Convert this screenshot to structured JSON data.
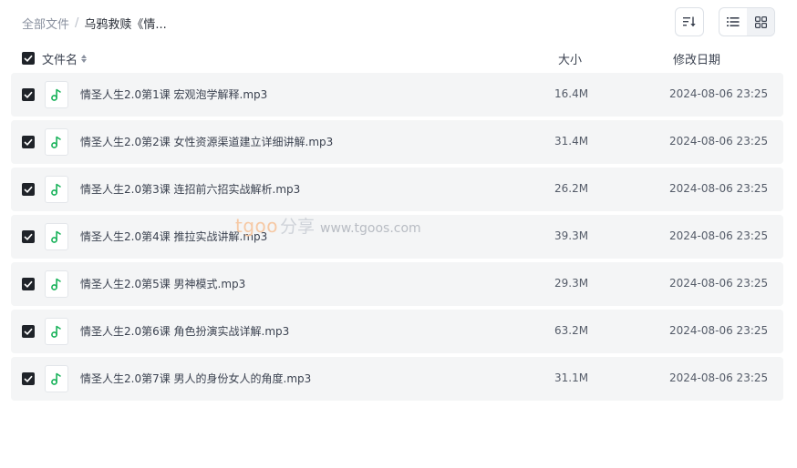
{
  "breadcrumb": {
    "root": "全部文件",
    "separator": "/",
    "current": "乌鸦救赎《情..."
  },
  "toolbar": {
    "sort_icon": "sort-icon",
    "list_view_icon": "list-view-icon",
    "grid_view_icon": "grid-view-icon"
  },
  "columns": {
    "name": "文件名",
    "size": "大小",
    "modified": "修改日期"
  },
  "files": [
    {
      "name": "情圣人生2.0第1课 宏观泡学解释.mp3",
      "size": "16.4M",
      "modified": "2024-08-06 23:25"
    },
    {
      "name": "情圣人生2.0第2课 女性资源渠道建立详细讲解.mp3",
      "size": "31.4M",
      "modified": "2024-08-06 23:25"
    },
    {
      "name": "情圣人生2.0第3课 连招前六招实战解析.mp3",
      "size": "26.2M",
      "modified": "2024-08-06 23:25"
    },
    {
      "name": "情圣人生2.0第4课 推拉实战讲解.mp3",
      "size": "39.3M",
      "modified": "2024-08-06 23:25"
    },
    {
      "name": "情圣人生2.0第5课 男神模式.mp3",
      "size": "29.3M",
      "modified": "2024-08-06 23:25"
    },
    {
      "name": "情圣人生2.0第6课 角色扮演实战详解.mp3",
      "size": "63.2M",
      "modified": "2024-08-06 23:25"
    },
    {
      "name": "情圣人生2.0第7课 男人的身份女人的角度.mp3",
      "size": "31.1M",
      "modified": "2024-08-06 23:25"
    }
  ],
  "watermark": {
    "brand": "tgoo",
    "cn": "分享",
    "url": "www.tgoos.com"
  },
  "colors": {
    "row_bg": "#f4f5f6",
    "checkbox": "#1f2329",
    "audio_icon": "#19b25a"
  }
}
